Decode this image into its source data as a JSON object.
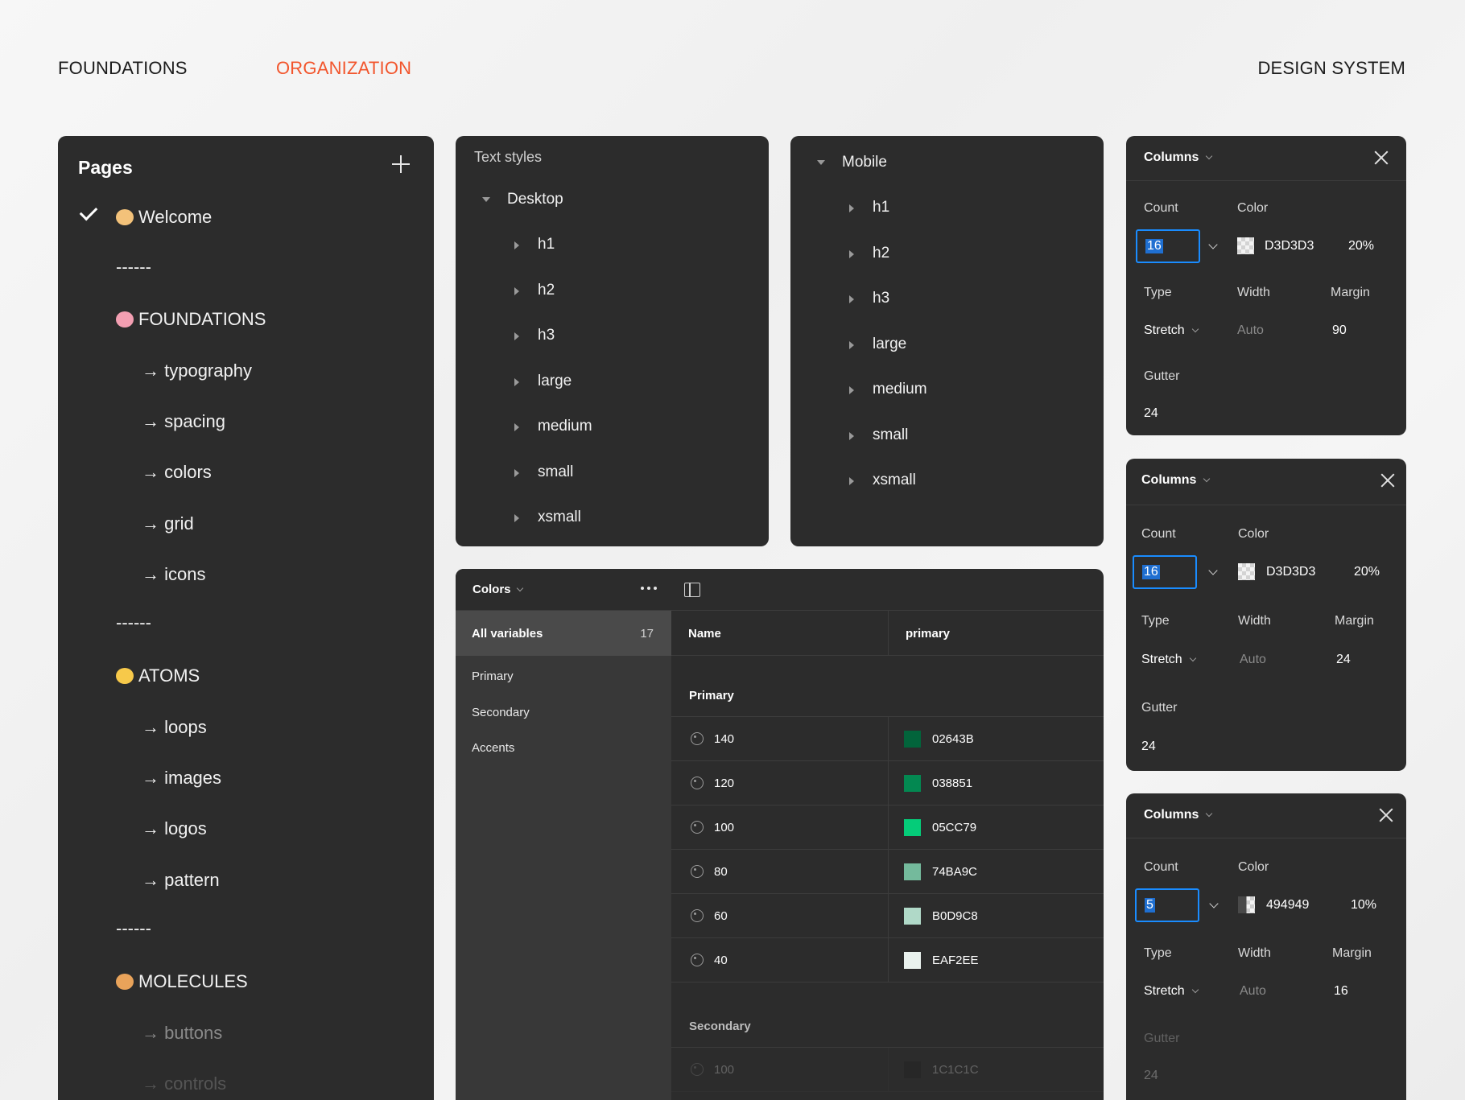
{
  "header": {
    "foundations": "FOUNDATIONS",
    "organization": "ORGANIZATION",
    "design_system": "DESIGN SYSTEM",
    "accent_color": "#f2552c"
  },
  "pages": {
    "title": "Pages",
    "items": [
      {
        "label": "Welcome"
      },
      {
        "label": "------"
      },
      {
        "label": "FOUNDATIONS"
      },
      {
        "label": "→ typography"
      },
      {
        "label": "→ spacing"
      },
      {
        "label": "→ colors"
      },
      {
        "label": "→ grid"
      },
      {
        "label": "→ icons"
      },
      {
        "label": "------"
      },
      {
        "label": "ATOMS"
      },
      {
        "label": "→ loops"
      },
      {
        "label": "→ images"
      },
      {
        "label": "→ logos"
      },
      {
        "label": "→ pattern"
      },
      {
        "label": "------"
      },
      {
        "label": "MOLECULES"
      },
      {
        "label": "→ buttons"
      },
      {
        "label": "→ controls"
      }
    ]
  },
  "text_styles": {
    "title": "Text styles",
    "group": "Desktop",
    "items": [
      "h1",
      "h2",
      "h3",
      "large",
      "medium",
      "small",
      "xsmall"
    ]
  },
  "mobile_styles": {
    "group": "Mobile",
    "items": [
      "h1",
      "h2",
      "h3",
      "large",
      "medium",
      "small",
      "xsmall"
    ]
  },
  "colors": {
    "title": "Colors",
    "all_variables": "All variables",
    "count": "17",
    "sidebar": [
      "Primary",
      "Secondary",
      "Accents"
    ],
    "col_name": "Name",
    "col_primary": "primary",
    "group_primary": "Primary",
    "rows": [
      {
        "name": "140",
        "hex": "02643B",
        "color": "#02643b"
      },
      {
        "name": "120",
        "hex": "038851",
        "color": "#038851"
      },
      {
        "name": "100",
        "hex": "05CC79",
        "color": "#05cc79"
      },
      {
        "name": "80",
        "hex": "74BA9C",
        "color": "#74ba9c"
      },
      {
        "name": "60",
        "hex": "B0D9C8",
        "color": "#b0d9c8"
      },
      {
        "name": "40",
        "hex": "EAF2EE",
        "color": "#eaf2ee"
      }
    ],
    "group_secondary": "Secondary",
    "secondary_row": {
      "name": "100",
      "hex": "1C1C1C",
      "color": "#1c1c1c"
    }
  },
  "columns_panels": [
    {
      "title": "Columns",
      "count_label": "Count",
      "color_label": "Color",
      "count": "16",
      "color_hex": "D3D3D3",
      "opacity": "20%",
      "type_label": "Type",
      "width_label": "Width",
      "margin_label": "Margin",
      "type": "Stretch",
      "width": "Auto",
      "margin": "90",
      "gutter_label": "Gutter",
      "gutter": "24"
    },
    {
      "title": "Columns",
      "count_label": "Count",
      "color_label": "Color",
      "count": "16",
      "color_hex": "D3D3D3",
      "opacity": "20%",
      "type_label": "Type",
      "width_label": "Width",
      "margin_label": "Margin",
      "type": "Stretch",
      "width": "Auto",
      "margin": "24",
      "gutter_label": "Gutter",
      "gutter": "24"
    },
    {
      "title": "Columns",
      "count_label": "Count",
      "color_label": "Color",
      "count": "5",
      "color_hex": "494949",
      "opacity": "10%",
      "type_label": "Type",
      "width_label": "Width",
      "margin_label": "Margin",
      "type": "Stretch",
      "width": "Auto",
      "margin": "16",
      "gutter_label": "Gutter",
      "gutter": "24"
    }
  ]
}
